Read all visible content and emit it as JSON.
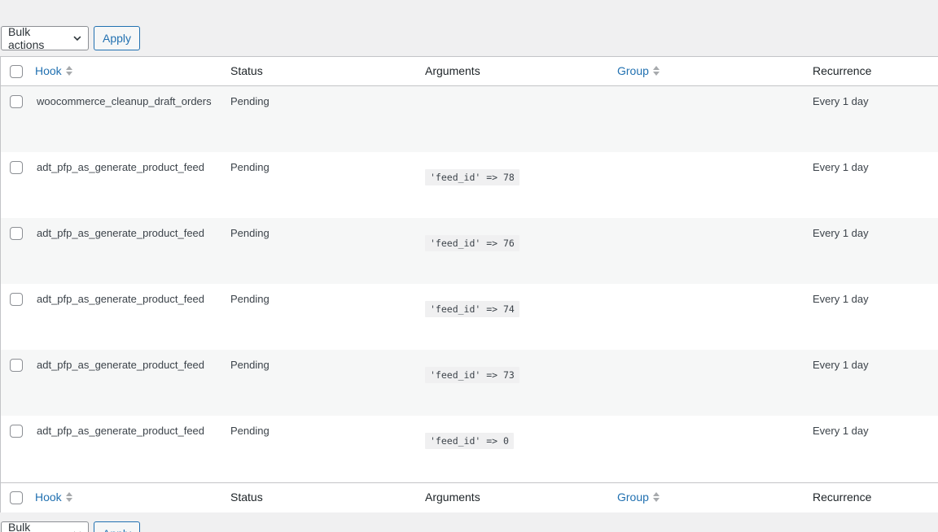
{
  "bulk": {
    "label": "Bulk actions",
    "apply": "Apply"
  },
  "columns": {
    "hook": "Hook",
    "status": "Status",
    "arguments": "Arguments",
    "group": "Group",
    "recurrence": "Recurrence"
  },
  "rows": [
    {
      "hook": "woocommerce_cleanup_draft_orders",
      "status": "Pending",
      "arguments": "",
      "group": "",
      "recurrence": "Every 1 day"
    },
    {
      "hook": "adt_pfp_as_generate_product_feed",
      "status": "Pending",
      "arguments": "'feed_id' => 78",
      "group": "",
      "recurrence": "Every 1 day"
    },
    {
      "hook": "adt_pfp_as_generate_product_feed",
      "status": "Pending",
      "arguments": "'feed_id' => 76",
      "group": "",
      "recurrence": "Every 1 day"
    },
    {
      "hook": "adt_pfp_as_generate_product_feed",
      "status": "Pending",
      "arguments": "'feed_id' => 74",
      "group": "",
      "recurrence": "Every 1 day"
    },
    {
      "hook": "adt_pfp_as_generate_product_feed",
      "status": "Pending",
      "arguments": "'feed_id' => 73",
      "group": "",
      "recurrence": "Every 1 day"
    },
    {
      "hook": "adt_pfp_as_generate_product_feed",
      "status": "Pending",
      "arguments": "'feed_id' => 0",
      "group": "",
      "recurrence": "Every 1 day"
    }
  ]
}
